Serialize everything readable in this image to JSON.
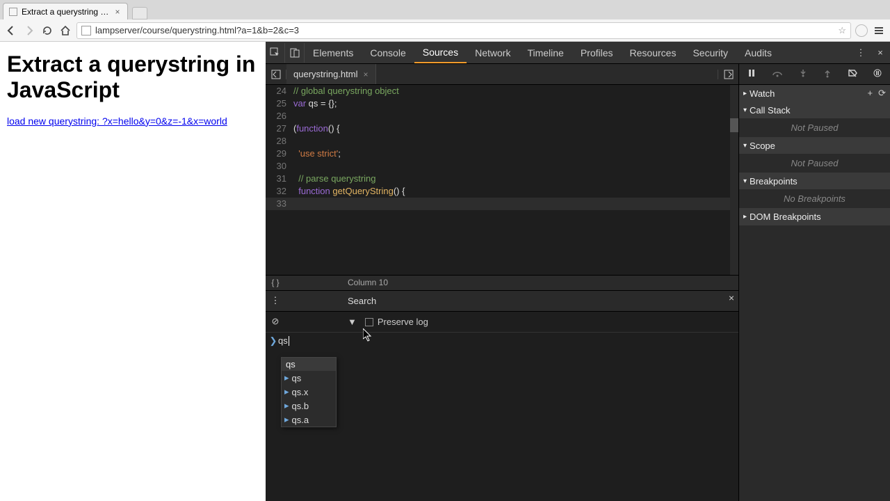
{
  "browser": {
    "tab_title": "Extract a querystring in Ja",
    "url": "lampserver/course/querystring.html?a=1&b=2&c=3"
  },
  "page": {
    "heading": "Extract a querystring in JavaScript",
    "link_text": "load new querystring: ?x=hello&y=0&z=-1&x=world"
  },
  "devtools": {
    "tabs": [
      "Elements",
      "Console",
      "Sources",
      "Network",
      "Timeline",
      "Profiles",
      "Resources",
      "Security",
      "Audits"
    ],
    "active_tab": "Sources",
    "file_tab": "querystring.html",
    "status_column": "Column 10",
    "search_label": "Search",
    "preserve_log_label": "Preserve log",
    "console_input": "qs",
    "autocomplete": {
      "head": "qs",
      "items": [
        "qs",
        "qs.x",
        "qs.b",
        "qs.a"
      ]
    },
    "code_lines": [
      {
        "n": 24,
        "t": "comment",
        "txt": "// global querystring object"
      },
      {
        "n": 25,
        "t": "var",
        "txt": "var qs = {};"
      },
      {
        "n": 26,
        "t": "blank",
        "txt": ""
      },
      {
        "n": 27,
        "t": "iife",
        "txt": "(function() {"
      },
      {
        "n": 28,
        "t": "blank",
        "txt": ""
      },
      {
        "n": 29,
        "t": "str",
        "txt": "  'use strict';"
      },
      {
        "n": 30,
        "t": "blank",
        "txt": ""
      },
      {
        "n": 31,
        "t": "comment",
        "txt": "  // parse querystring"
      },
      {
        "n": 32,
        "t": "func",
        "txt": "  function getQueryString() {"
      },
      {
        "n": 33,
        "t": "hl",
        "txt": ""
      }
    ],
    "sidebar": {
      "watch": "Watch",
      "call_stack": "Call Stack",
      "scope": "Scope",
      "breakpoints": "Breakpoints",
      "dom_breakpoints": "DOM Breakpoints",
      "not_paused": "Not Paused",
      "no_breakpoints": "No Breakpoints"
    }
  }
}
